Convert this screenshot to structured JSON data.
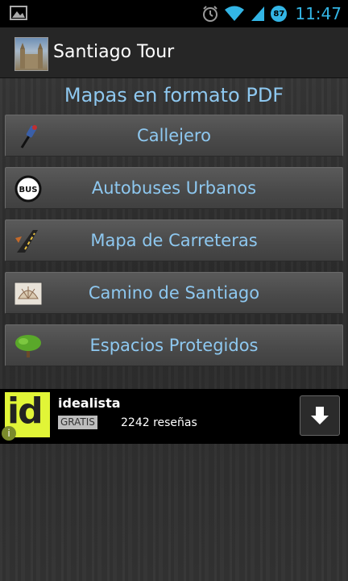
{
  "status_bar": {
    "time": "11:47",
    "battery_level": "87",
    "icons": [
      "gallery-icon",
      "alarm-icon",
      "wifi-icon",
      "signal-icon",
      "battery-icon"
    ]
  },
  "action_bar": {
    "title": "Santiago Tour",
    "icon": "cathedral-app-icon"
  },
  "section_title": "Mapas en formato PDF",
  "menu": [
    {
      "label": "Callejero",
      "icon": "pushpin-icon"
    },
    {
      "label": "Autobuses Urbanos",
      "icon": "bus-icon"
    },
    {
      "label": "Mapa de Carreteras",
      "icon": "road-icon"
    },
    {
      "label": "Camino de Santiago",
      "icon": "scallop-shell-icon"
    },
    {
      "label": "Espacios Protegidos",
      "icon": "tree-icon"
    }
  ],
  "ad": {
    "logo_text": "id",
    "app_name": "idealista",
    "price": "GRATIS",
    "reviews": "2242 reseñas",
    "info_icon": "info-icon",
    "download_icon": "download-icon"
  },
  "colors": {
    "accent_blue": "#8ec8f0",
    "status_blue": "#33b5e5",
    "ad_logo": "#e1f537"
  }
}
